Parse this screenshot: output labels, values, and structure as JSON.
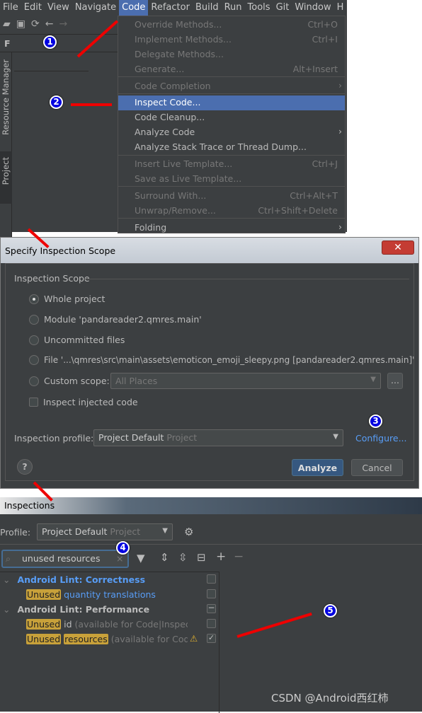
{
  "menubar": [
    "File",
    "Edit",
    "View",
    "Navigate",
    "Code",
    "Refactor",
    "Build",
    "Run",
    "Tools",
    "Git",
    "Window",
    "H"
  ],
  "active_menu": "Code",
  "side_tabs": {
    "resource_manager": "Resource Manager",
    "project": "Project",
    "f": "F"
  },
  "code_menu": [
    {
      "label": "Override Methods...",
      "shortcut": "Ctrl+O",
      "disabled": true
    },
    {
      "label": "Implement Methods...",
      "shortcut": "Ctrl+I",
      "disabled": true
    },
    {
      "label": "Delegate Methods...",
      "disabled": true
    },
    {
      "label": "Generate...",
      "shortcut": "Alt+Insert",
      "disabled": true
    },
    {
      "label": "Code Completion",
      "disabled": true,
      "submenu": true
    },
    {
      "label": "Inspect Code...",
      "selected": true
    },
    {
      "label": "Code Cleanup..."
    },
    {
      "label": "Analyze Code",
      "submenu": true
    },
    {
      "label": "Analyze Stack Trace or Thread Dump..."
    },
    {
      "label": "Insert Live Template...",
      "shortcut": "Ctrl+J",
      "disabled": true
    },
    {
      "label": "Save as Live Template...",
      "disabled": true
    },
    {
      "label": "Surround With...",
      "shortcut": "Ctrl+Alt+T",
      "disabled": true
    },
    {
      "label": "Unwrap/Remove...",
      "shortcut": "Ctrl+Shift+Delete",
      "disabled": true
    },
    {
      "label": "Folding",
      "submenu": true
    }
  ],
  "badges": [
    "1",
    "2",
    "3",
    "4",
    "5"
  ],
  "dialog": {
    "title": "Specify Inspection Scope",
    "close": "✕",
    "section": "Inspection Scope",
    "options": [
      "Whole project",
      "Module 'pandareader2.qmres.main'",
      "Uncommitted files",
      "File '...\\qmres\\src\\main\\assets\\emoticon_emoji_sleepy.png [pandareader2.qmres.main]'",
      "Custom scope:"
    ],
    "selected_option": "Whole project",
    "custom_scope_value": "All Places",
    "browse": "...",
    "inject_label": "Inspect injected code",
    "profile_label": "Inspection profile:",
    "profile_value": "Project Default",
    "profile_scope": "Project",
    "configure": "Configure...",
    "help": "?",
    "analyze": "Analyze",
    "cancel": "Cancel"
  },
  "inspections": {
    "title": "Inspections",
    "profile_label": "Profile:",
    "profile_value": "Project Default",
    "profile_scope": "Project",
    "search_value": "unused resources",
    "tree": [
      {
        "group": "Android Lint: Correctness",
        "state": "unchecked",
        "items": [
          {
            "hl": [
              "Unused"
            ],
            "rest": "quantity translations",
            "state": "unchecked"
          }
        ]
      },
      {
        "group": "Android Lint: Performance",
        "state": "mixed",
        "items": [
          {
            "hl": [
              "Unused"
            ],
            "rest": "id",
            "note": "(available for Code|Inspect C",
            "state": "unchecked"
          },
          {
            "hl": [
              "Unused",
              "resources"
            ],
            "note": "(available for Code|I",
            "warning": true,
            "state": "checked"
          }
        ]
      }
    ]
  },
  "watermark": "CSDN @Android西红柿",
  "colors": {
    "accent": "#4b6eaf",
    "highlight": "#c8a13a",
    "link": "#589df6",
    "arrow": "#e00000"
  }
}
